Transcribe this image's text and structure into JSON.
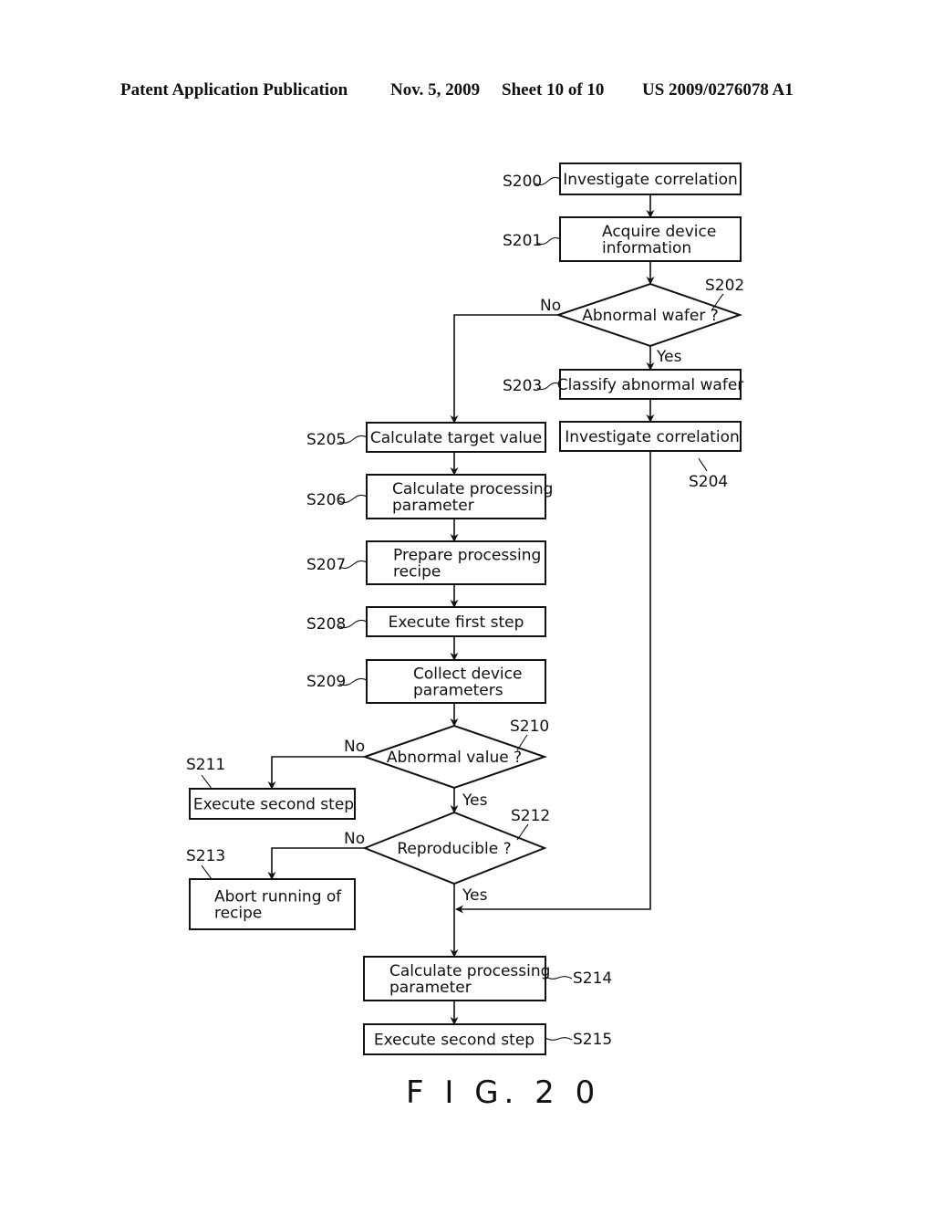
{
  "header": {
    "publication": "Patent Application Publication",
    "date": "Nov. 5, 2009",
    "sheet": "Sheet 10 of 10",
    "number": "US 2009/0276078 A1"
  },
  "figure_label": "F I G. 2 0",
  "flowchart": {
    "nodes": [
      {
        "id": "S200",
        "type": "process",
        "lines": [
          "Investigate correlation"
        ]
      },
      {
        "id": "S201",
        "type": "process",
        "lines": [
          "Acquire device",
          "information"
        ]
      },
      {
        "id": "S202",
        "type": "decision",
        "lines": [
          "Abnormal wafer ?"
        ]
      },
      {
        "id": "S203",
        "type": "process",
        "lines": [
          "Classify abnormal wafer"
        ]
      },
      {
        "id": "S204",
        "type": "process",
        "lines": [
          "Investigate correlation"
        ]
      },
      {
        "id": "S205",
        "type": "process",
        "lines": [
          "Calculate target value"
        ]
      },
      {
        "id": "S206",
        "type": "process",
        "lines": [
          "Calculate processing",
          "parameter"
        ]
      },
      {
        "id": "S207",
        "type": "process",
        "lines": [
          "Prepare processing",
          "recipe"
        ]
      },
      {
        "id": "S208",
        "type": "process",
        "lines": [
          "Execute first step"
        ]
      },
      {
        "id": "S209",
        "type": "process",
        "lines": [
          "Collect device",
          "parameters"
        ]
      },
      {
        "id": "S210",
        "type": "decision",
        "lines": [
          "Abnormal value ?"
        ]
      },
      {
        "id": "S211",
        "type": "process",
        "lines": [
          "Execute second step"
        ]
      },
      {
        "id": "S212",
        "type": "decision",
        "lines": [
          "Reproducible ?"
        ]
      },
      {
        "id": "S213",
        "type": "process",
        "lines": [
          "Abort running of",
          "recipe"
        ]
      },
      {
        "id": "S214",
        "type": "process",
        "lines": [
          "Calculate processing",
          "parameter"
        ]
      },
      {
        "id": "S215",
        "type": "process",
        "lines": [
          "Execute second step"
        ]
      }
    ],
    "edge_labels": {
      "s202_no": "No",
      "s202_yes": "Yes",
      "s210_no": "No",
      "s210_yes": "Yes",
      "s212_no": "No",
      "s212_yes": "Yes"
    },
    "edges": [
      {
        "from": "S200",
        "to": "S201"
      },
      {
        "from": "S201",
        "to": "S202"
      },
      {
        "from": "S202",
        "to": "S203",
        "label": "Yes"
      },
      {
        "from": "S202",
        "to": "S205",
        "label": "No"
      },
      {
        "from": "S203",
        "to": "S204"
      },
      {
        "from": "S204",
        "to": "S214"
      },
      {
        "from": "S205",
        "to": "S206"
      },
      {
        "from": "S206",
        "to": "S207"
      },
      {
        "from": "S207",
        "to": "S208"
      },
      {
        "from": "S208",
        "to": "S209"
      },
      {
        "from": "S209",
        "to": "S210"
      },
      {
        "from": "S210",
        "to": "S211",
        "label": "No"
      },
      {
        "from": "S210",
        "to": "S212",
        "label": "Yes"
      },
      {
        "from": "S212",
        "to": "S213",
        "label": "No"
      },
      {
        "from": "S212",
        "to": "S214",
        "label": "Yes"
      },
      {
        "from": "S214",
        "to": "S215"
      }
    ]
  }
}
